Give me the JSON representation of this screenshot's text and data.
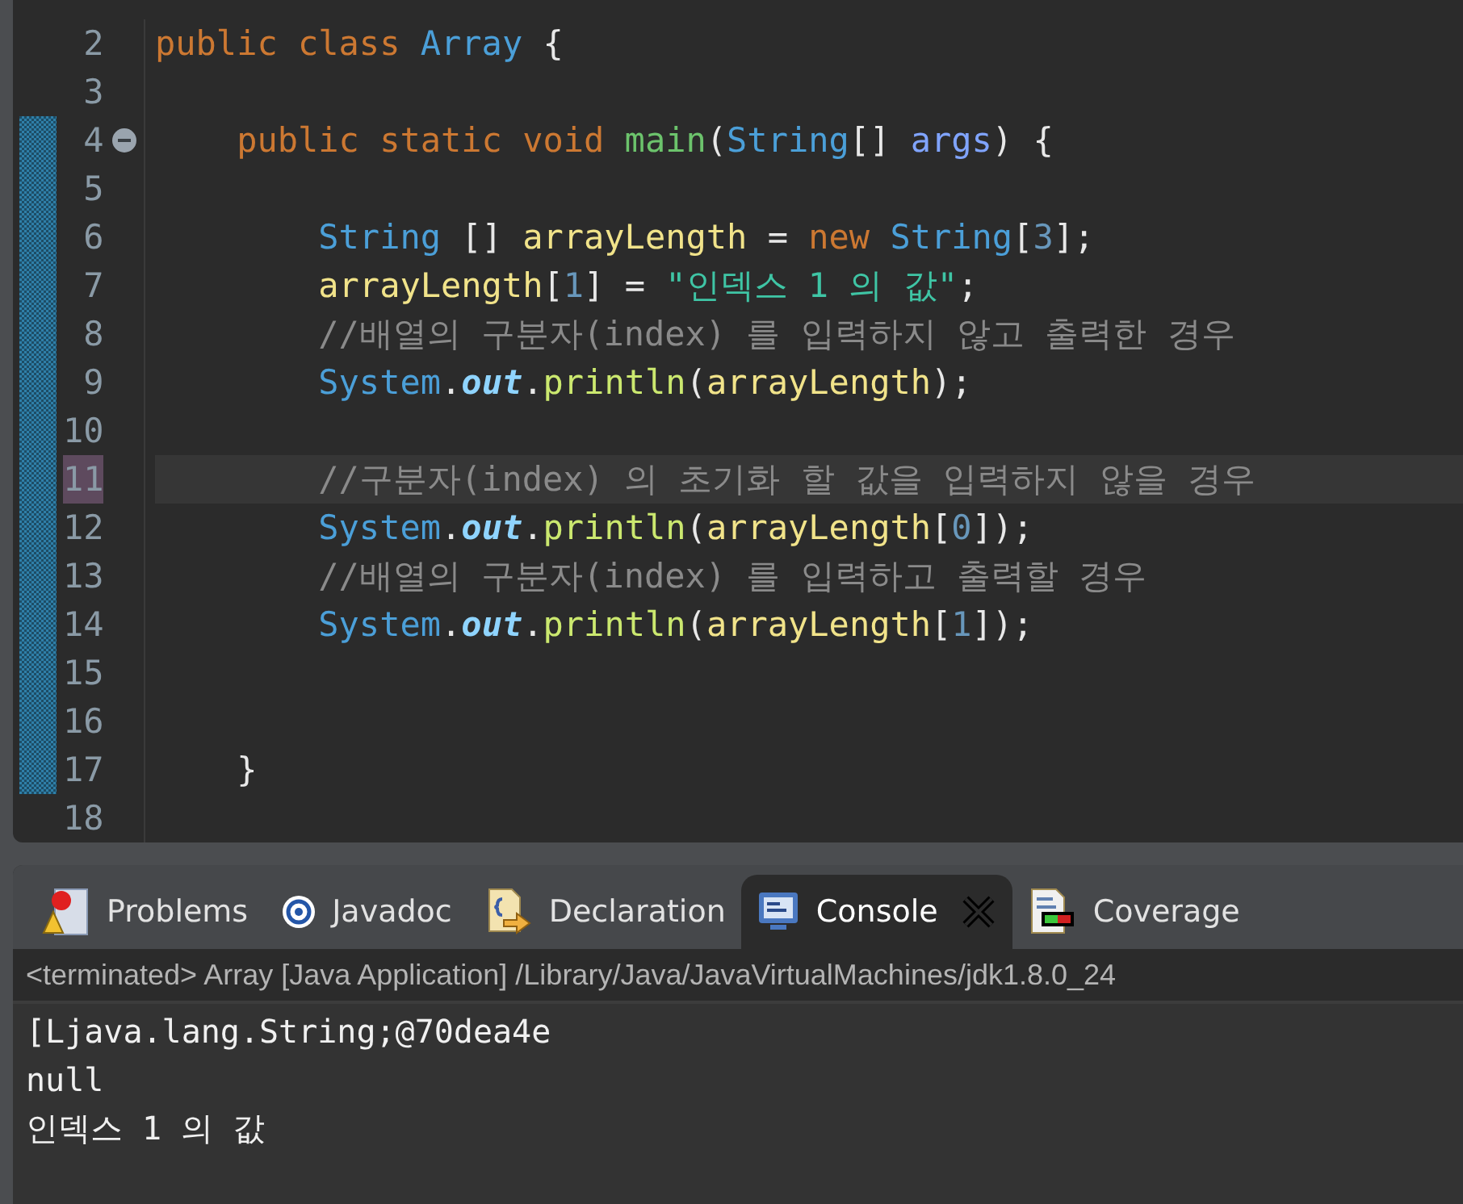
{
  "editor": {
    "lines": [
      {
        "number": "2",
        "changed": false,
        "current": false,
        "foldable": false,
        "tokens": [
          {
            "kind": "keyword",
            "text": "public class "
          },
          {
            "kind": "type",
            "text": "Array"
          },
          {
            "kind": "plain",
            "text": " {"
          }
        ]
      },
      {
        "number": "3",
        "changed": false,
        "current": false,
        "foldable": false
      },
      {
        "number": "4",
        "changed": true,
        "current": false,
        "foldable": true,
        "tokens": [
          {
            "kind": "keyword",
            "text": "    public static void "
          },
          {
            "kind": "method",
            "text": "main"
          },
          {
            "kind": "plain",
            "text": "("
          },
          {
            "kind": "type",
            "text": "String"
          },
          {
            "kind": "plain",
            "text": "[] "
          },
          {
            "kind": "param",
            "text": "args"
          },
          {
            "kind": "plain",
            "text": ") {"
          }
        ]
      },
      {
        "number": "5",
        "changed": true,
        "current": false,
        "foldable": false
      },
      {
        "number": "6",
        "changed": true,
        "current": false,
        "foldable": false,
        "tokens": [
          {
            "kind": "type",
            "text": "        String"
          },
          {
            "kind": "plain",
            "text": " [] "
          },
          {
            "kind": "var",
            "text": "arrayLength"
          },
          {
            "kind": "plain",
            "text": " = "
          },
          {
            "kind": "keyword",
            "text": "new "
          },
          {
            "kind": "type",
            "text": "String"
          },
          {
            "kind": "plain",
            "text": "["
          },
          {
            "kind": "number",
            "text": "3"
          },
          {
            "kind": "plain",
            "text": "];"
          }
        ]
      },
      {
        "number": "7",
        "changed": true,
        "current": false,
        "foldable": false,
        "tokens": [
          {
            "kind": "var",
            "text": "        arrayLength"
          },
          {
            "kind": "plain",
            "text": "["
          },
          {
            "kind": "number",
            "text": "1"
          },
          {
            "kind": "plain",
            "text": "] = "
          },
          {
            "kind": "string",
            "text": "\"인덱스 1 의 값\""
          },
          {
            "kind": "plain",
            "text": ";"
          }
        ]
      },
      {
        "number": "8",
        "changed": true,
        "current": false,
        "foldable": false,
        "tokens": [
          {
            "kind": "comment",
            "text": "        //배열의 구분자(index) 를 입력하지 않고 출력한 경우"
          }
        ]
      },
      {
        "number": "9",
        "changed": true,
        "current": false,
        "foldable": false,
        "tokens": [
          {
            "kind": "type",
            "text": "        System"
          },
          {
            "kind": "plain",
            "text": "."
          },
          {
            "kind": "field",
            "text": "out"
          },
          {
            "kind": "plain",
            "text": "."
          },
          {
            "kind": "call",
            "text": "println"
          },
          {
            "kind": "plain",
            "text": "("
          },
          {
            "kind": "var",
            "text": "arrayLength"
          },
          {
            "kind": "plain",
            "text": ");"
          }
        ]
      },
      {
        "number": "10",
        "changed": true,
        "current": false,
        "foldable": false
      },
      {
        "number": "11",
        "changed": true,
        "current": true,
        "foldable": false,
        "tokens": [
          {
            "kind": "comment",
            "text": "        //구분자(index) 의 초기화 할 값을 입력하지 않을 경우"
          }
        ]
      },
      {
        "number": "12",
        "changed": true,
        "current": false,
        "foldable": false,
        "tokens": [
          {
            "kind": "type",
            "text": "        System"
          },
          {
            "kind": "plain",
            "text": "."
          },
          {
            "kind": "field",
            "text": "out"
          },
          {
            "kind": "plain",
            "text": "."
          },
          {
            "kind": "call",
            "text": "println"
          },
          {
            "kind": "plain",
            "text": "("
          },
          {
            "kind": "var",
            "text": "arrayLength"
          },
          {
            "kind": "plain",
            "text": "["
          },
          {
            "kind": "number",
            "text": "0"
          },
          {
            "kind": "plain",
            "text": "]);"
          }
        ]
      },
      {
        "number": "13",
        "changed": true,
        "current": false,
        "foldable": false,
        "tokens": [
          {
            "kind": "comment",
            "text": "        //배열의 구분자(index) 를 입력하고 출력할 경우"
          }
        ]
      },
      {
        "number": "14",
        "changed": true,
        "current": false,
        "foldable": false,
        "tokens": [
          {
            "kind": "type",
            "text": "        System"
          },
          {
            "kind": "plain",
            "text": "."
          },
          {
            "kind": "field",
            "text": "out"
          },
          {
            "kind": "plain",
            "text": "."
          },
          {
            "kind": "call",
            "text": "println"
          },
          {
            "kind": "plain",
            "text": "("
          },
          {
            "kind": "var",
            "text": "arrayLength"
          },
          {
            "kind": "plain",
            "text": "["
          },
          {
            "kind": "number",
            "text": "1"
          },
          {
            "kind": "plain",
            "text": "]);"
          }
        ]
      },
      {
        "number": "15",
        "changed": true,
        "current": false,
        "foldable": false
      },
      {
        "number": "16",
        "changed": true,
        "current": false,
        "foldable": false
      },
      {
        "number": "17",
        "changed": true,
        "current": false,
        "foldable": false,
        "tokens": [
          {
            "kind": "plain",
            "text": "    }"
          }
        ]
      },
      {
        "number": "18",
        "changed": false,
        "current": false,
        "foldable": false
      }
    ]
  },
  "panel": {
    "tabs": [
      {
        "label": "Problems",
        "selected": false,
        "closable": false
      },
      {
        "label": "Javadoc",
        "selected": false,
        "closable": false
      },
      {
        "label": "Declaration",
        "selected": false,
        "closable": false
      },
      {
        "label": "Console",
        "selected": true,
        "closable": true
      },
      {
        "label": "Coverage",
        "selected": false,
        "closable": false
      }
    ],
    "status": "<terminated> Array [Java Application] /Library/Java/JavaVirtualMachines/jdk1.8.0_24",
    "output": [
      "[Ljava.lang.String;@70dea4e",
      "null",
      "인덱스 1 의 값"
    ]
  }
}
